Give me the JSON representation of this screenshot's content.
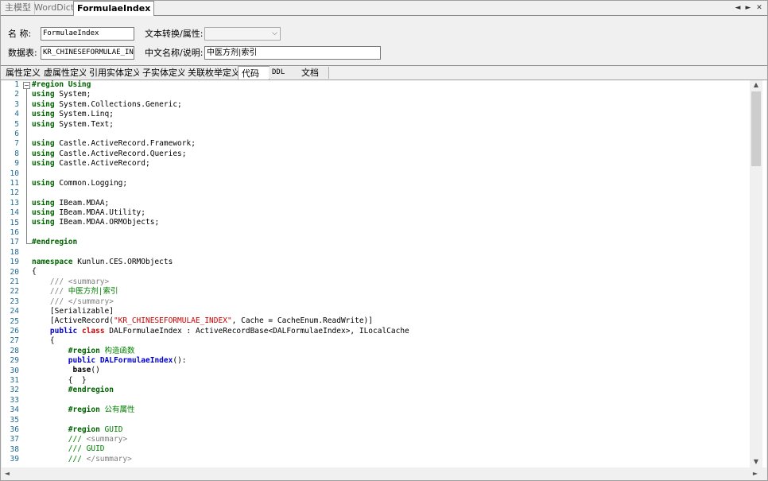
{
  "doc_tabs": [
    "主模型",
    "WordDict",
    "FormulaeIndex"
  ],
  "tab_controls": {
    "prev": "◄",
    "next": "►",
    "close": "✕"
  },
  "form": {
    "name_label": "名  称:",
    "name_value": "FormulaeIndex",
    "table_label": "数据表:",
    "table_value": "KR_CHINESEFORMULAE_INDEX",
    "convert_label": "文本转换/属性:",
    "convert_value": "",
    "cnname_label": "中文名称/说明:",
    "cnname_value": "中医方剂|索引"
  },
  "sub_tabs": [
    "属性定义",
    "虚属性定义",
    "引用实体定义",
    "子实体定义",
    "关联枚举定义",
    "代码",
    "DDL",
    "文档"
  ],
  "active_sub_tab": "代码",
  "fold_marker": "−",
  "scrollbar": {
    "up": "▲",
    "down": "▼",
    "left": "◄",
    "right": "►"
  },
  "line_numbers": [
    "1",
    "2",
    "3",
    "4",
    "5",
    "6",
    "7",
    "8",
    "9",
    "10",
    "11",
    "12",
    "13",
    "14",
    "15",
    "16",
    "17",
    "18",
    "19",
    "20",
    "21",
    "22",
    "23",
    "24",
    "25",
    "26",
    "27",
    "28",
    "29",
    "30",
    "31",
    "32",
    "33",
    "34",
    "35",
    "36",
    "37",
    "38",
    "39"
  ],
  "code": {
    "l1": [
      "#region Using"
    ],
    "l2": [
      "using",
      " System;"
    ],
    "l3": [
      "using",
      " System.Collections.Generic;"
    ],
    "l4": [
      "using",
      " System.Linq;"
    ],
    "l5": [
      "using",
      " System.Text;"
    ],
    "l6": [
      ""
    ],
    "l7": [
      "using",
      " Castle.ActiveRecord.Framework;"
    ],
    "l8": [
      "using",
      " Castle.ActiveRecord.Queries;"
    ],
    "l9": [
      "using",
      " Castle.ActiveRecord;"
    ],
    "l10": [
      ""
    ],
    "l11": [
      "using",
      " Common.Logging;"
    ],
    "l12": [
      ""
    ],
    "l13": [
      "using",
      " IBeam.MDAA;"
    ],
    "l14": [
      "using",
      " IBeam.MDAA.Utility;"
    ],
    "l15": [
      "using",
      " IBeam.MDAA.ORMObjects;"
    ],
    "l16": [
      ""
    ],
    "l17": [
      "#endregion"
    ],
    "l18": [
      ""
    ],
    "l19": [
      "namespace",
      " Kunlun.CES.ORMObjects"
    ],
    "l20": [
      "{"
    ],
    "l21": [
      "    /// ",
      "<summary>"
    ],
    "l22": [
      "    /// ",
      "中医方剂|索引"
    ],
    "l23": [
      "    /// ",
      "</summary>"
    ],
    "l24": [
      "    [Serializable]"
    ],
    "l25": [
      "    [ActiveRecord(",
      "\"KR_CHINESEFORMULAE_INDEX\"",
      ", Cache = CacheEnum.ReadWrite)]"
    ],
    "l26": [
      "    ",
      "public",
      " ",
      "class",
      " DALFormulaeIndex : ActiveRecordBase<DALFormulaeIndex>, ILocalCache"
    ],
    "l27": [
      "    {"
    ],
    "l28": [
      "        ",
      "#region",
      " 构造函数"
    ],
    "l29": [
      "        ",
      "public",
      " ",
      "DALFormulaeIndex",
      "():"
    ],
    "l30": [
      "         ",
      "base",
      "()"
    ],
    "l31": [
      "        {  }"
    ],
    "l32": [
      "        ",
      "#endregion"
    ],
    "l33": [
      ""
    ],
    "l34": [
      "        ",
      "#region",
      " 公有属性"
    ],
    "l35": [
      ""
    ],
    "l36": [
      "        ",
      "#region",
      " GUID"
    ],
    "l37": [
      "        /// ",
      "<summary>"
    ],
    "l38": [
      "        /// ",
      "GUID"
    ],
    "l39": [
      "        /// ",
      "</summary>"
    ]
  }
}
